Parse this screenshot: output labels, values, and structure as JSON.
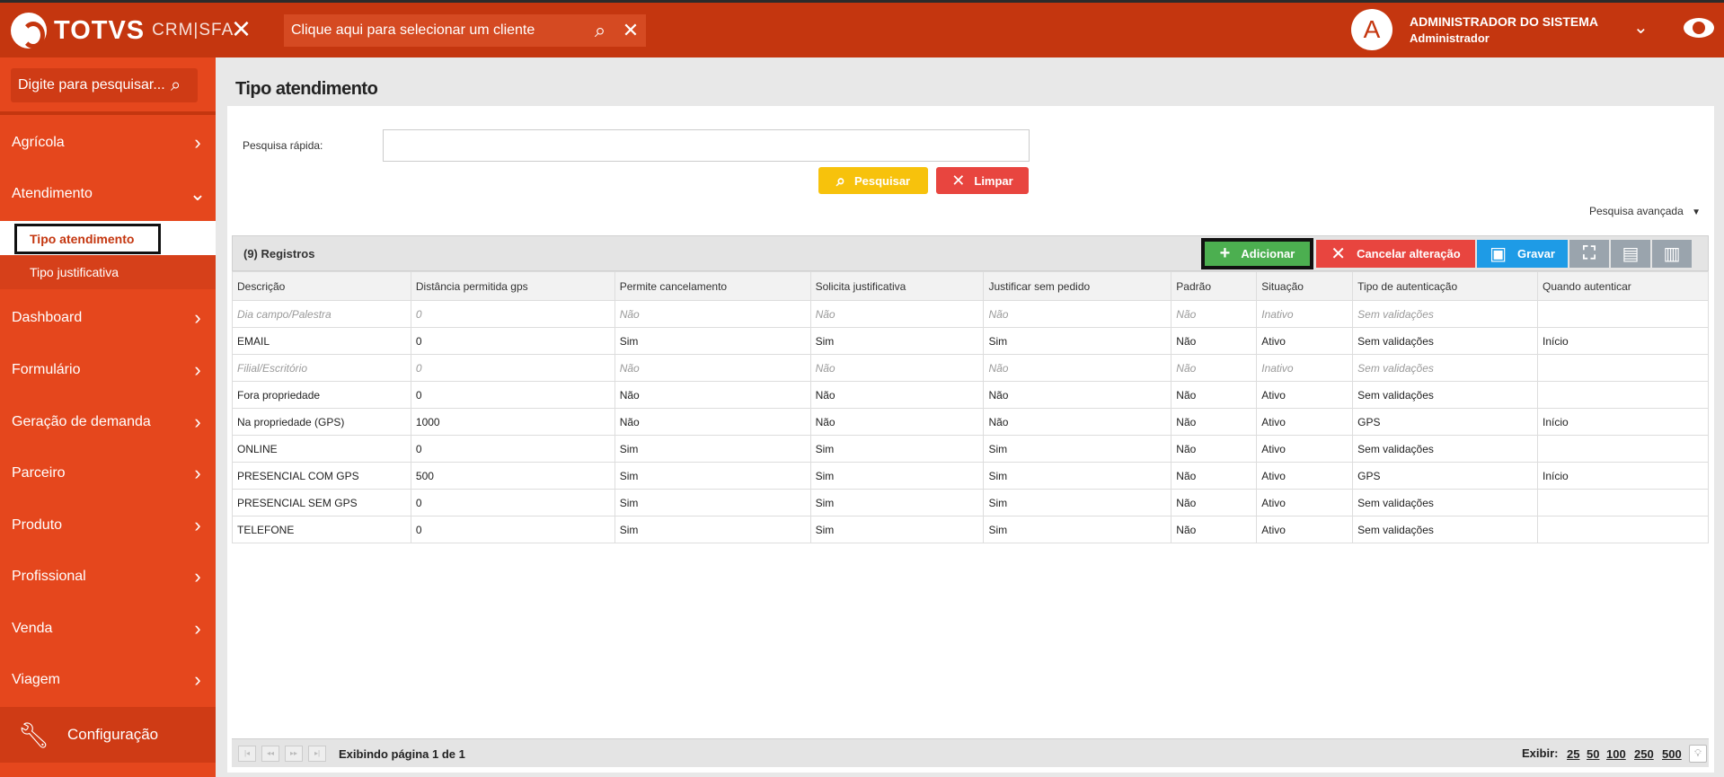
{
  "header": {
    "brand": "TOTVS",
    "product": "CRM|SFA",
    "client_placeholder": "Clique aqui para selecionar um cliente",
    "user_initial": "A",
    "user_name": "ADMINISTRADOR DO SISTEMA",
    "user_role": "Administrador"
  },
  "sidebar": {
    "search_placeholder": "Digite para pesquisar...",
    "items": [
      {
        "label": "Agrícola"
      },
      {
        "label": "Atendimento"
      },
      {
        "label": "Dashboard"
      },
      {
        "label": "Formulário"
      },
      {
        "label": "Geração de demanda"
      },
      {
        "label": "Parceiro"
      },
      {
        "label": "Produto"
      },
      {
        "label": "Profissional"
      },
      {
        "label": "Venda"
      },
      {
        "label": "Viagem"
      }
    ],
    "sub_items": [
      {
        "label": "Tipo atendimento"
      },
      {
        "label": "Tipo justificativa"
      }
    ],
    "config_label": "Configuração"
  },
  "main": {
    "title": "Tipo atendimento",
    "quick_search_label": "Pesquisa rápida:",
    "search_button": "Pesquisar",
    "clear_button": "Limpar",
    "advanced_search": "Pesquisa avançada",
    "records_count": "(9) Registros",
    "toolbar": {
      "add": "Adicionar",
      "cancel": "Cancelar alteração",
      "save": "Gravar"
    },
    "columns": [
      "Descrição",
      "Distância permitida gps",
      "Permite cancelamento",
      "Solicita justificativa",
      "Justificar sem pedido",
      "Padrão",
      "Situação",
      "Tipo de autenticação",
      "Quando autenticar"
    ],
    "rows": [
      [
        "Dia campo/Palestra",
        "0",
        "Não",
        "Não",
        "Não",
        "Não",
        "Inativo",
        "Sem validações",
        ""
      ],
      [
        "EMAIL",
        "0",
        "Sim",
        "Sim",
        "Sim",
        "Não",
        "Ativo",
        "Sem validações",
        "Início"
      ],
      [
        "Filial/Escritório",
        "0",
        "Não",
        "Não",
        "Não",
        "Não",
        "Inativo",
        "Sem validações",
        ""
      ],
      [
        "Fora propriedade",
        "0",
        "Não",
        "Não",
        "Não",
        "Não",
        "Ativo",
        "Sem validações",
        ""
      ],
      [
        "Na propriedade (GPS)",
        "1000",
        "Não",
        "Não",
        "Não",
        "Não",
        "Ativo",
        "GPS",
        "Início"
      ],
      [
        "ONLINE",
        "0",
        "Sim",
        "Sim",
        "Sim",
        "Não",
        "Ativo",
        "Sem validações",
        ""
      ],
      [
        "PRESENCIAL COM GPS",
        "500",
        "Sim",
        "Sim",
        "Sim",
        "Não",
        "Ativo",
        "GPS",
        "Início"
      ],
      [
        "PRESENCIAL SEM GPS",
        "0",
        "Sim",
        "Sim",
        "Sim",
        "Não",
        "Ativo",
        "Sem validações",
        ""
      ],
      [
        "TELEFONE",
        "0",
        "Sim",
        "Sim",
        "Sim",
        "Não",
        "Ativo",
        "Sem validações",
        ""
      ]
    ],
    "pager": {
      "info": "Exibindo página 1 de 1",
      "show_label": "Exibir:",
      "options": [
        "25",
        "50",
        "100",
        "250",
        "500"
      ]
    }
  },
  "colors": {
    "topbar": "#c4360f",
    "sidebar": "#e5471d",
    "add": "#4caf50",
    "cancel": "#e8453f",
    "save": "#1e9be6",
    "search": "#f7c20c"
  }
}
